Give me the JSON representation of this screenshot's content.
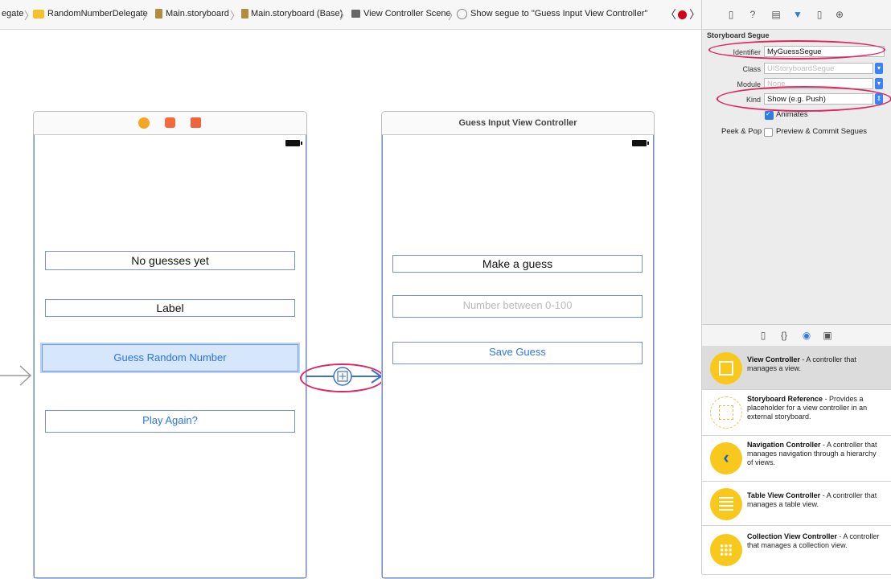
{
  "breadcrumb": {
    "items": [
      "egate",
      "RandomNumberDelegate",
      "Main.storyboard",
      "Main.storyboard (Base)",
      "View Controller Scene",
      "Show segue to \"Guess Input View Controller\""
    ],
    "separator": "〉"
  },
  "nav": {
    "back": "〈",
    "forward": "〉"
  },
  "scene1": {
    "title": "",
    "labels": {
      "status": "No guesses yet",
      "label": "Label"
    },
    "buttons": {
      "guess": "Guess Random Number",
      "play_again": "Play Again?"
    }
  },
  "scene2": {
    "title": "Guess Input View Controller",
    "prompt": "Make a guess",
    "textfield_placeholder": "Number between 0-100",
    "save_button": "Save Guess"
  },
  "inspector": {
    "section": "Storyboard Segue",
    "identifier_label": "Identifier",
    "identifier_value": "MyGuessSegue",
    "class_label": "Class",
    "class_placeholder": "UIStoryboardSegue",
    "module_label": "Module",
    "module_placeholder": "None",
    "kind_label": "Kind",
    "kind_value": "Show (e.g. Push)",
    "animates_label": "Animates",
    "animates_checked": true,
    "peek_label": "Peek & Pop",
    "peek_option": "Preview & Commit Segues",
    "peek_checked": false
  },
  "library": {
    "items": [
      {
        "name": "View Controller",
        "desc": " - A controller that manages a view."
      },
      {
        "name": "Storyboard Reference",
        "desc": " - Provides a placeholder for a view controller in an external storyboard."
      },
      {
        "name": "Navigation Controller",
        "desc": " - A controller that manages navigation through a hierarchy of views."
      },
      {
        "name": "Table View Controller",
        "desc": " - A controller that manages a table view."
      },
      {
        "name": "Collection View Controller",
        "desc": " - A controller that manages a collection view."
      }
    ]
  },
  "colors": {
    "accent": "#2b74e8",
    "callout": "#e0245e",
    "selection": "#d6e6fb",
    "library_icon": "#f8c81c"
  }
}
